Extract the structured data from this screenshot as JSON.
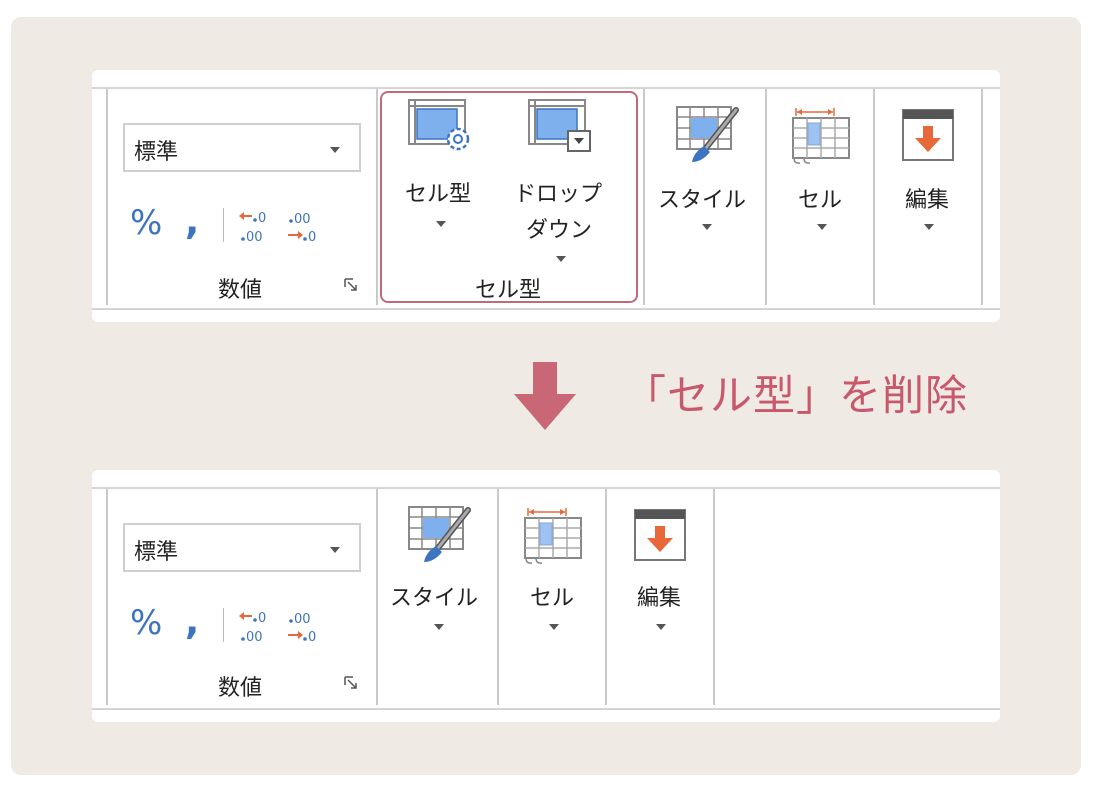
{
  "before": {
    "number_format_value": "標準",
    "percent_label": "%",
    "comma_label": "‚",
    "group_number_label": "数値",
    "celltype_button_label": "セル型",
    "dropdown_button_label_1": "ドロップ",
    "dropdown_button_label_2": "ダウン",
    "group_celltype_label": "セル型",
    "style_button_label": "スタイル",
    "cell_button_label": "セル",
    "edit_button_label": "編集"
  },
  "after": {
    "number_format_value": "標準",
    "percent_label": "%",
    "comma_label": "‚",
    "group_number_label": "数値",
    "style_button_label": "スタイル",
    "cell_button_label": "セル",
    "edit_button_label": "編集"
  },
  "caption": "「セル型」を削除",
  "colors": {
    "accent": "#c8586b",
    "icon_blue": "#3d74c0",
    "icon_orange": "#e8683a",
    "background": "#efebe4"
  }
}
